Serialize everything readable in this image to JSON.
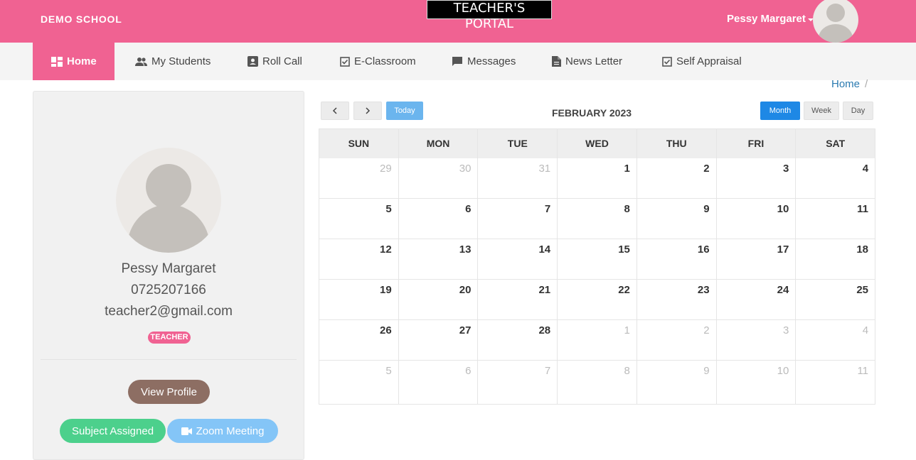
{
  "header": {
    "school_name": "DEMO SCHOOL",
    "portal_title": "TEACHER'S PORTAL",
    "user_name": "Pessy Margaret",
    "accent_color": "#f06292"
  },
  "nav": {
    "items": [
      {
        "label": "Home",
        "icon": "dashboard-icon",
        "active": true
      },
      {
        "label": "My Students",
        "icon": "people-icon"
      },
      {
        "label": "Roll Call",
        "icon": "contact-card-icon"
      },
      {
        "label": "E-Classroom",
        "icon": "checkbox-icon"
      },
      {
        "label": "Messages",
        "icon": "chat-bubble-icon"
      },
      {
        "label": "News Letter",
        "icon": "document-icon"
      },
      {
        "label": "Self Appraisal",
        "icon": "checkbox-icon"
      }
    ]
  },
  "breadcrumb": {
    "home": "Home",
    "separator": "/"
  },
  "profile": {
    "name": "Pessy Margaret",
    "phone": "0725207166",
    "email": "teacher2@gmail.com",
    "role": "TEACHER",
    "view_profile_label": "View Profile",
    "subject_assigned_label": "Subject Assigned",
    "zoom_meeting_label": "Zoom Meeting"
  },
  "calendar": {
    "title": "FEBRUARY 2023",
    "today_label": "Today",
    "month_label": "Month",
    "week_label": "Week",
    "day_label": "Day",
    "view_selected": "Month",
    "days": [
      "SUN",
      "MON",
      "TUE",
      "WED",
      "THU",
      "FRI",
      "SAT"
    ],
    "weeks": [
      [
        {
          "d": "29",
          "o": true
        },
        {
          "d": "30",
          "o": true
        },
        {
          "d": "31",
          "o": true
        },
        {
          "d": "1"
        },
        {
          "d": "2"
        },
        {
          "d": "3"
        },
        {
          "d": "4"
        }
      ],
      [
        {
          "d": "5"
        },
        {
          "d": "6"
        },
        {
          "d": "7"
        },
        {
          "d": "8"
        },
        {
          "d": "9"
        },
        {
          "d": "10"
        },
        {
          "d": "11"
        }
      ],
      [
        {
          "d": "12"
        },
        {
          "d": "13"
        },
        {
          "d": "14"
        },
        {
          "d": "15"
        },
        {
          "d": "16"
        },
        {
          "d": "17"
        },
        {
          "d": "18"
        }
      ],
      [
        {
          "d": "19"
        },
        {
          "d": "20"
        },
        {
          "d": "21"
        },
        {
          "d": "22"
        },
        {
          "d": "23"
        },
        {
          "d": "24"
        },
        {
          "d": "25"
        }
      ],
      [
        {
          "d": "26"
        },
        {
          "d": "27"
        },
        {
          "d": "28"
        },
        {
          "d": "1",
          "o": true
        },
        {
          "d": "2",
          "o": true
        },
        {
          "d": "3",
          "o": true
        },
        {
          "d": "4",
          "o": true
        }
      ],
      [
        {
          "d": "5",
          "o": true
        },
        {
          "d": "6",
          "o": true
        },
        {
          "d": "7",
          "o": true
        },
        {
          "d": "8",
          "o": true
        },
        {
          "d": "9",
          "o": true
        },
        {
          "d": "10",
          "o": true
        },
        {
          "d": "11",
          "o": true
        }
      ]
    ]
  }
}
